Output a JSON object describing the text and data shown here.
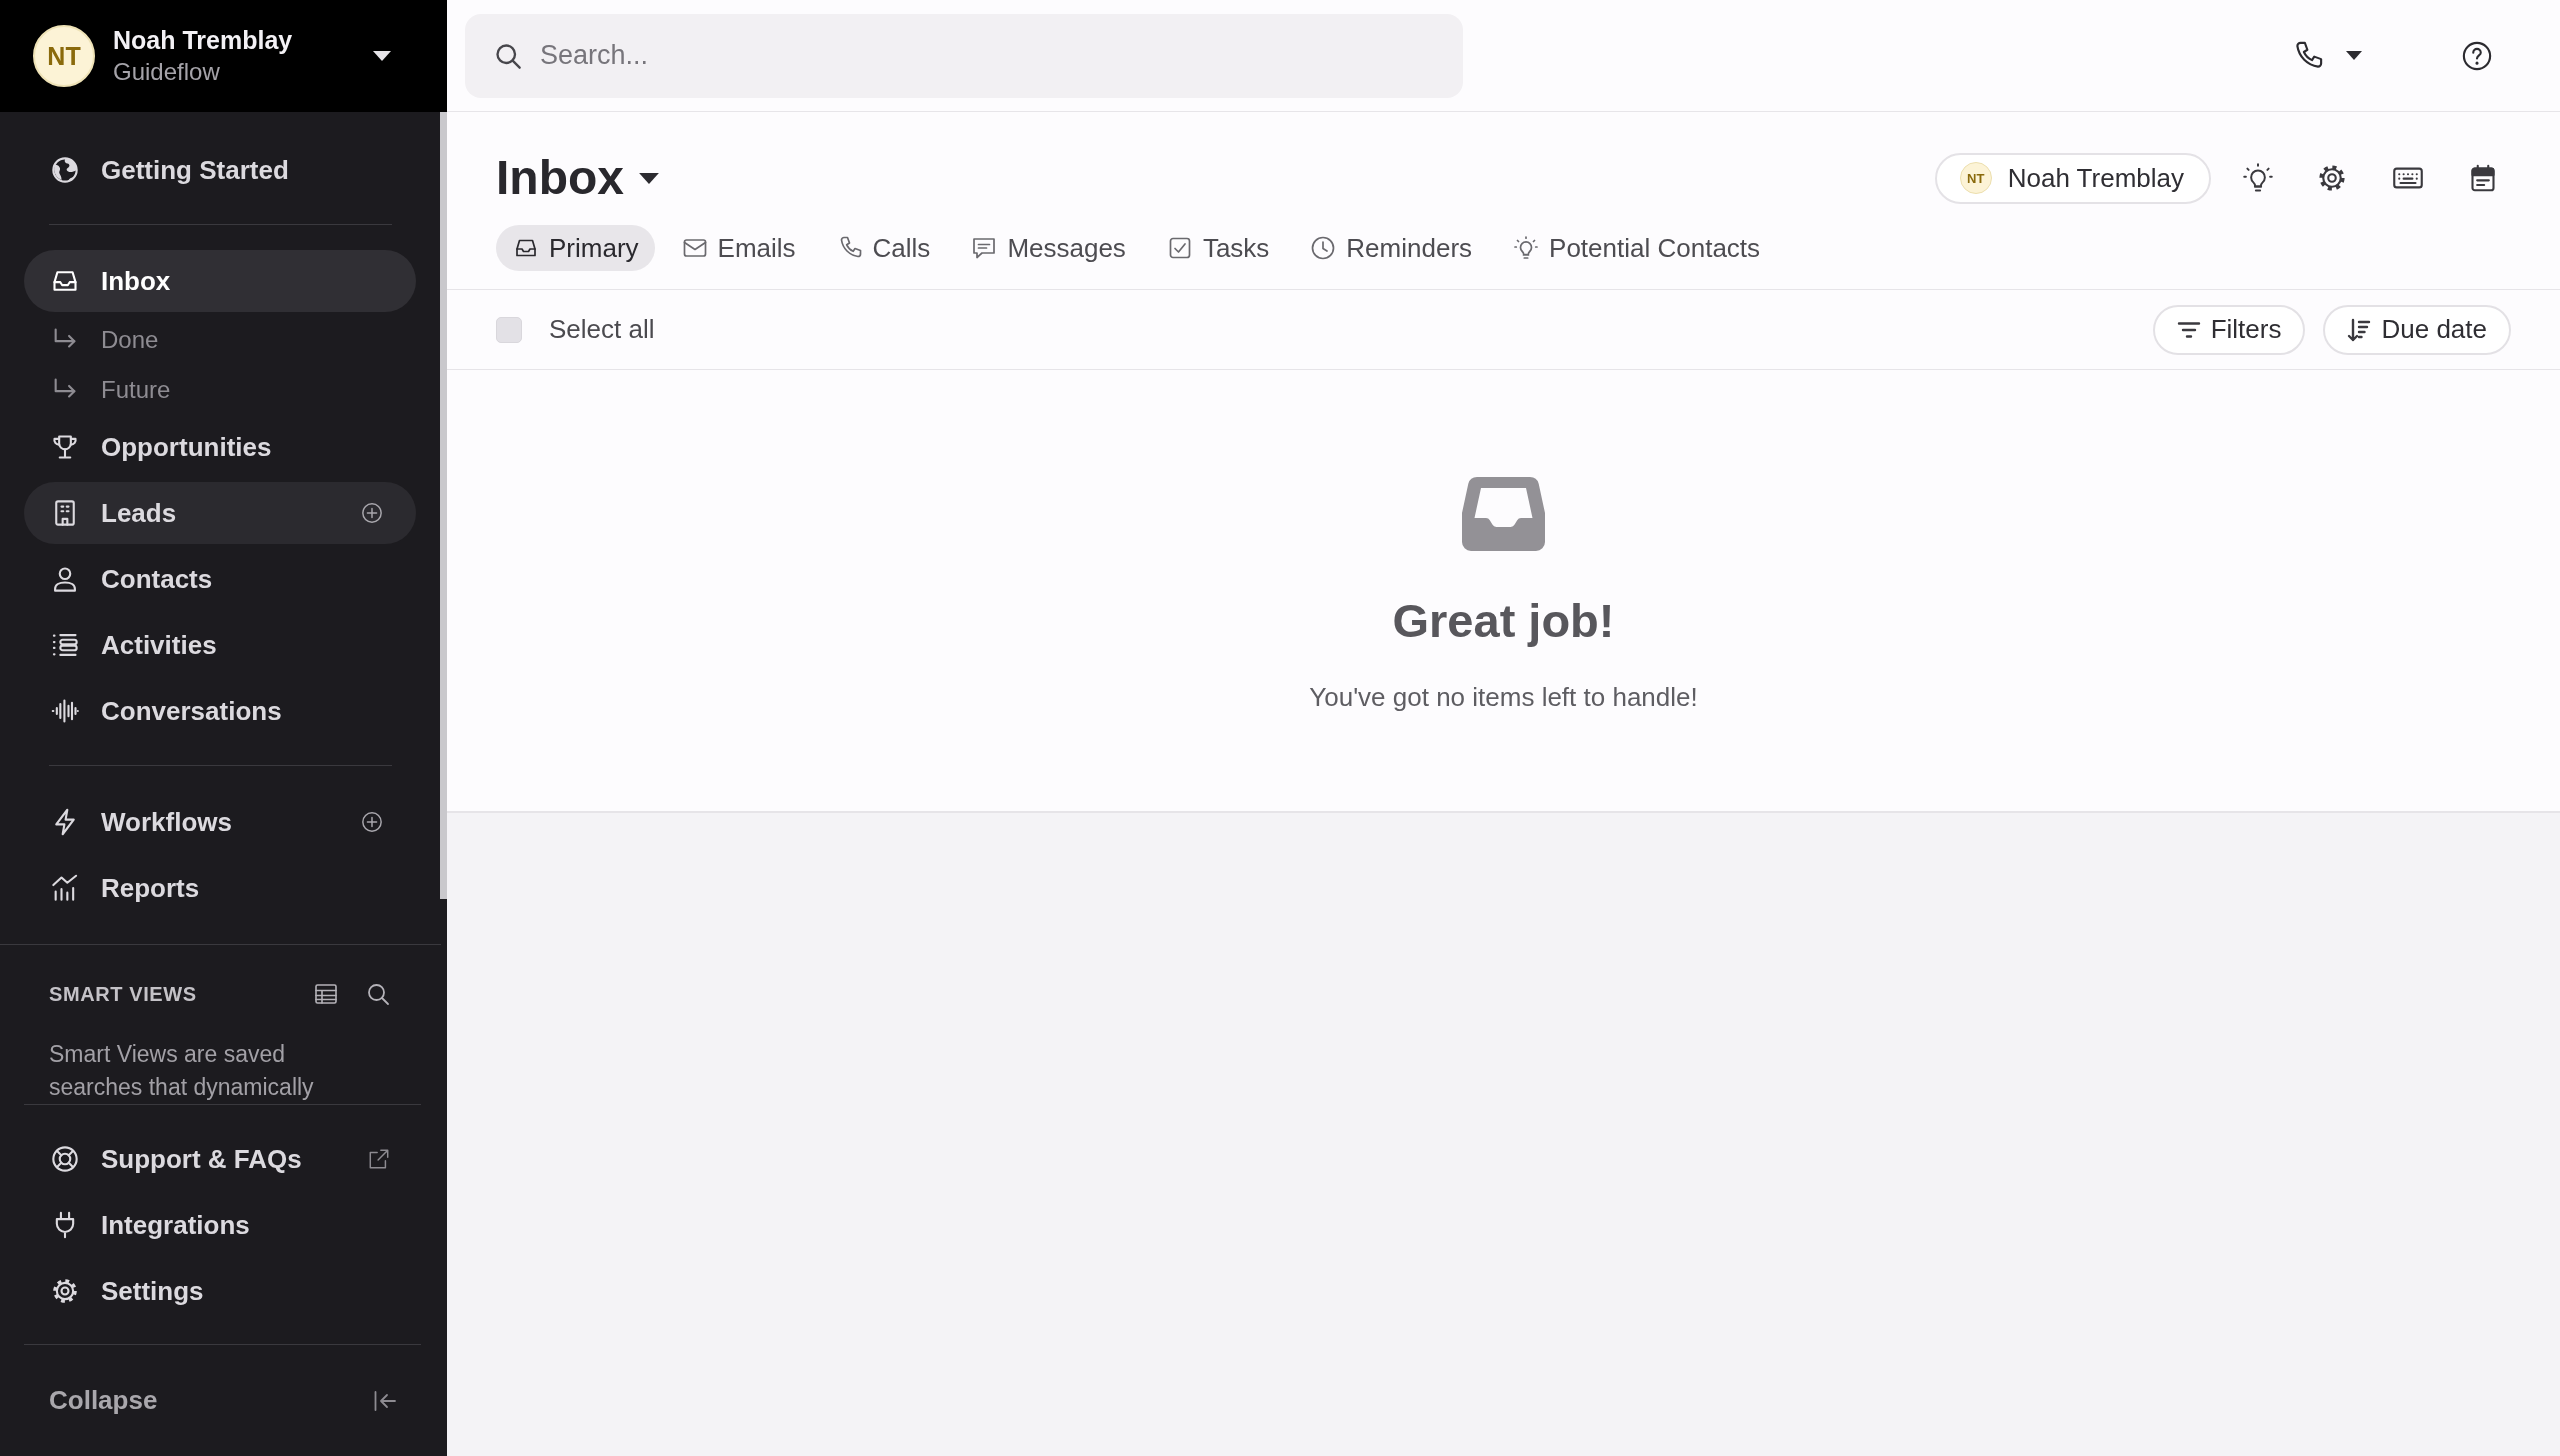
{
  "account": {
    "initials": "NT",
    "name": "Noah Tremblay",
    "workspace": "Guideflow"
  },
  "sidebar": {
    "sections": [
      {
        "items": [
          {
            "label": "Getting Started",
            "selected": false,
            "highlighted": false,
            "add_button": false
          }
        ]
      },
      {
        "items": [
          {
            "label": "Inbox",
            "selected": true,
            "highlighted": false,
            "add_button": false,
            "children": [
              {
                "label": "Done",
                "selected": false
              },
              {
                "label": "Future",
                "selected": false
              }
            ]
          },
          {
            "label": "Opportunities",
            "selected": false,
            "highlighted": false,
            "add_button": false
          },
          {
            "label": "Leads",
            "selected": false,
            "highlighted": true,
            "add_button": true
          },
          {
            "label": "Contacts",
            "selected": false,
            "highlighted": false,
            "add_button": false
          },
          {
            "label": "Activities",
            "selected": false,
            "highlighted": false,
            "add_button": false
          },
          {
            "label": "Conversations",
            "selected": false,
            "highlighted": false,
            "add_button": false
          }
        ]
      },
      {
        "items": [
          {
            "label": "Workflows",
            "selected": false,
            "highlighted": false,
            "add_button": true
          },
          {
            "label": "Reports",
            "selected": false,
            "highlighted": false,
            "add_button": false
          }
        ]
      }
    ],
    "smart_views": {
      "title": "SMART VIEWS",
      "description": "Smart Views are saved searches that dynamically"
    },
    "footer_items": [
      {
        "label": "Support & FAQs",
        "selected": false,
        "external": true
      },
      {
        "label": "Integrations",
        "selected": false,
        "external": false
      },
      {
        "label": "Settings",
        "selected": false,
        "external": false
      }
    ],
    "collapse": "Collapse"
  },
  "search": {
    "placeholder": "Search..."
  },
  "page": {
    "title": "Inbox",
    "owner": {
      "initials": "NT",
      "name": "Noah Tremblay"
    }
  },
  "tabs": [
    {
      "label": "Primary",
      "selected": true
    },
    {
      "label": "Emails",
      "selected": false
    },
    {
      "label": "Calls",
      "selected": false
    },
    {
      "label": "Messages",
      "selected": false
    },
    {
      "label": "Tasks",
      "selected": false
    },
    {
      "label": "Reminders",
      "selected": false
    },
    {
      "label": "Potential Contacts",
      "selected": false
    }
  ],
  "toolbar": {
    "select_all": {
      "label": "Select all",
      "checked": false
    },
    "buttons": [
      "Filters",
      "Due date"
    ]
  },
  "empty_state": {
    "title": "Great job!",
    "message": "You've got no items left to handle!"
  }
}
